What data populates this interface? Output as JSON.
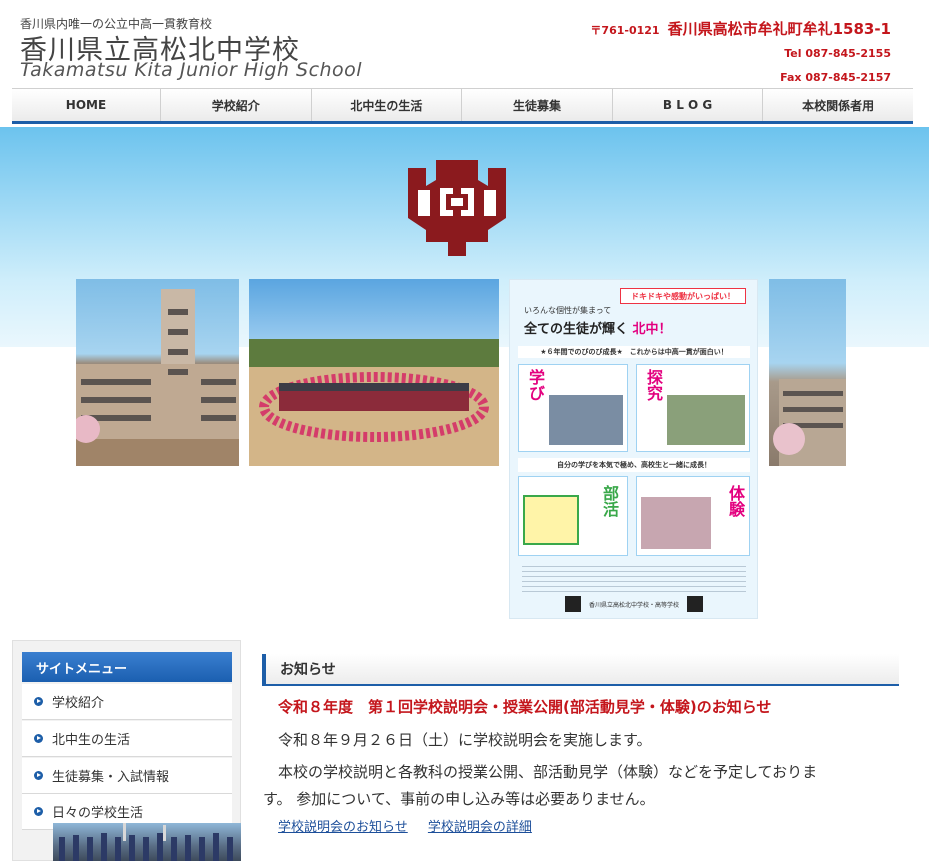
{
  "header": {
    "tagline": "香川県内唯一の公立中高一貫教育校",
    "school_name": "香川県立高松北中学校",
    "school_name_en": "Takamatsu Kita Junior High School",
    "postal": "〒761-0121",
    "address": "香川県高松市牟礼町牟礼1583-1",
    "tel": "Tel 087-845-2155",
    "fax": "Fax 087-845-2157"
  },
  "nav": {
    "items": [
      "HOME",
      "学校紹介",
      "北中生の生活",
      "生徒募集",
      "B L O G",
      "本校関係者用"
    ]
  },
  "hero": {
    "emblem_icon": "school-emblem-icon",
    "emblem_color": "#8b1a1e",
    "poster": {
      "banner": "ドキドキや感動がいっぱい！",
      "line1": "いろんな個性が集まって",
      "line2_pre": "全ての生徒が輝く",
      "line2_hl": "北中！",
      "row1": "★６年間でのびのび成長★　これからは中高一貫が面白い！",
      "word_manabi": "学び",
      "word_tankyu": "探究",
      "word_bukatsu": "部活",
      "word_taiken": "体験",
      "mid": "自分の学びを本気で極め、高校生と一緒に成長！",
      "foot": "香川県立高松北中学校・高等学校"
    }
  },
  "sidebar": {
    "title": "サイトメニュー",
    "items": [
      {
        "label": "学校紹介"
      },
      {
        "label": "北中生の生活"
      },
      {
        "label": "生徒募集・入試情報"
      },
      {
        "label": "日々の学校生活"
      }
    ]
  },
  "news": {
    "heading": "お知らせ",
    "title": "令和８年度　第１回学校説明会・授業公開(部活動見学・体験)のお知らせ",
    "body1": "令和８年９月２６日（土）に学校説明会を実施します。",
    "body2": "本校の学校説明と各教科の授業公開、部活動見学（体験）などを予定しておりま",
    "body3": "す。 参加について、事前の申し込み等は必要ありません。",
    "link1": "学校説明会のお知らせ",
    "link2": "学校説明会の詳細"
  },
  "colors": {
    "accent_red": "#c4161c",
    "nav_blue": "#1d5ea8"
  }
}
